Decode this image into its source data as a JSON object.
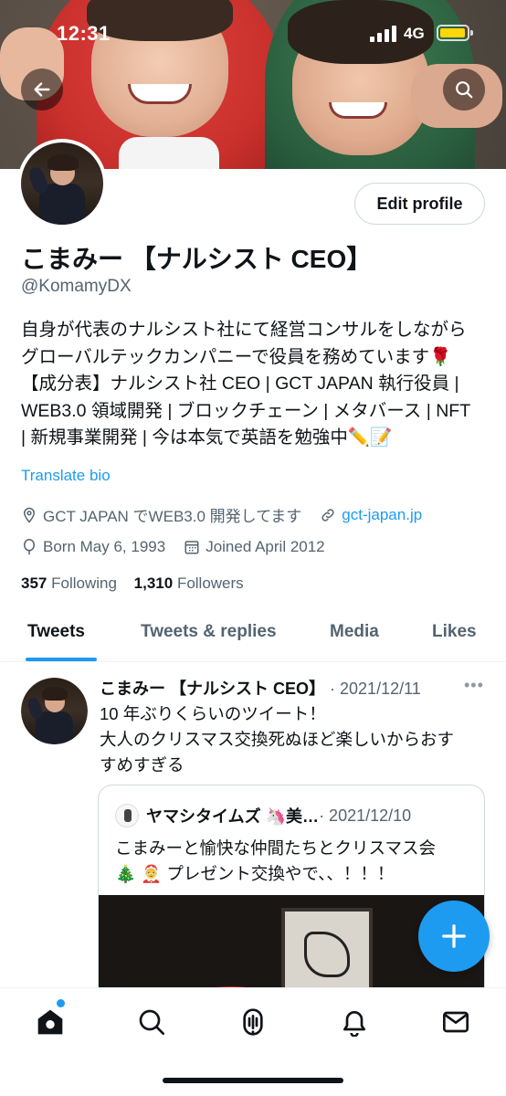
{
  "status_bar": {
    "time": "12:31",
    "network": "4G"
  },
  "profile": {
    "name": "こまみー 【ナルシスト CEO】",
    "handle": "@KomamyDX",
    "edit_label": "Edit profile",
    "bio_lines": [
      "自身が代表のナルシスト社にて経営コンサルをしながら",
      "グローバルテックカンパニーで役員を務めています🌹",
      "【成分表】ナルシスト社 CEO | GCT JAPAN 執行役員 |",
      "WEB3.0 領域開発 | ブロックチェーン | メタバース | NFT",
      "| 新規事業開発 | 今は本気で英語を勉強中✏️📝"
    ],
    "translate_label": "Translate bio",
    "location": "GCT JAPAN でWEB3.0 開発してます",
    "website": "gct-japan.jp",
    "born": "Born May 6, 1993",
    "joined": "Joined April 2012",
    "following_count": "357",
    "following_label": "Following",
    "followers_count": "1,310",
    "followers_label": "Followers"
  },
  "tabs": [
    {
      "label": "Tweets",
      "active": true
    },
    {
      "label": "Tweets & replies",
      "active": false
    },
    {
      "label": "Media",
      "active": false
    },
    {
      "label": "Likes",
      "active": false
    }
  ],
  "tweet": {
    "author": "こまみー 【ナルシスト CEO】",
    "date": "· 2021/12/11",
    "more": "•••",
    "text_lines": [
      "10 年ぶりくらいのツイート！",
      "大人のクリスマス交換死ぬほど楽しいからおす",
      "すめすぎる"
    ],
    "quote": {
      "author": "ヤマシタイムズ 🦄美…",
      "date": "· 2021/12/10",
      "text_lines": [
        "こまみーと愉快な仲間たちとクリスマス会",
        "🎄 🤶 プレゼント交換やで、、！！！"
      ]
    }
  },
  "icons": {
    "back": "back-arrow-icon",
    "search": "search-icon",
    "location": "location-pin-icon",
    "link": "link-icon",
    "born": "balloon-icon",
    "joined": "calendar-icon",
    "compose": "plus-icon",
    "nav": [
      "home-icon",
      "search-icon",
      "spaces-icon",
      "notifications-icon",
      "messages-icon"
    ]
  },
  "colors": {
    "accent": "#1d9bf0",
    "text": "#0f1419",
    "secondary": "#536471"
  }
}
